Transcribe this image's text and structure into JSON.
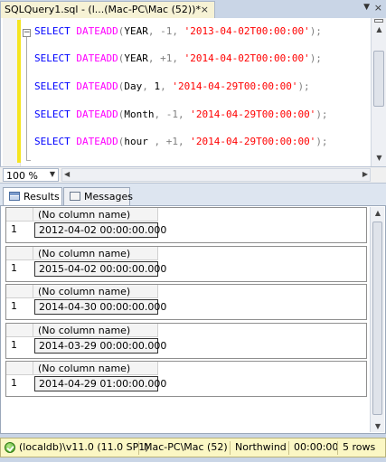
{
  "document_tab": {
    "title": "SQLQuery1.sql - (l...(Mac-PC\\Mac (52))*",
    "close_glyph": "×"
  },
  "editor": {
    "lines": [
      {
        "kw": "SELECT",
        "fn": "DATEADD",
        "open": "(",
        "part": "YEAR",
        "sep1": ", ",
        "num": "-1",
        "sep2": ", ",
        "str": "'2013-04-02T00:00:00'",
        "close": ");"
      },
      {
        "kw": "SELECT",
        "fn": "DATEADD",
        "open": "(",
        "part": "YEAR",
        "sep1": ", ",
        "num": "+1",
        "sep2": ", ",
        "str": "'2014-04-02T00:00:00'",
        "close": ");"
      },
      {
        "kw": "SELECT",
        "fn": "DATEADD",
        "open": "(",
        "part": "Day",
        "sep1": ", ",
        "num": "1",
        "sep2": ", ",
        "str": "'2014-04-29T00:00:00'",
        "close": ");"
      },
      {
        "kw": "SELECT",
        "fn": "DATEADD",
        "open": "(",
        "part": "Month",
        "sep1": ", ",
        "num": "-1",
        "sep2": ", ",
        "str": "'2014-04-29T00:00:00'",
        "close": ");"
      },
      {
        "kw": "SELECT",
        "fn": "DATEADD",
        "open": "(",
        "part": "hour ",
        "sep1": ", ",
        "num": "+1",
        "sep2": ", ",
        "str": "'2014-04-29T00:00:00'",
        "close": ");"
      }
    ],
    "collapse_glyph": "−"
  },
  "zoom": {
    "value": "100 %"
  },
  "result_tabs": {
    "results": "Results",
    "messages": "Messages"
  },
  "result_sets": [
    {
      "column": "(No column name)",
      "row": "1",
      "value": "2012-04-02 00:00:00.000"
    },
    {
      "column": "(No column name)",
      "row": "1",
      "value": "2015-04-02 00:00:00.000"
    },
    {
      "column": "(No column name)",
      "row": "1",
      "value": "2014-04-30 00:00:00.000"
    },
    {
      "column": "(No column name)",
      "row": "1",
      "value": "2014-03-29 00:00:00.000"
    },
    {
      "column": "(No column name)",
      "row": "1",
      "value": "2014-04-29 01:00:00.000"
    }
  ],
  "status": {
    "server": "(localdb)\\v11.0 (11.0 SP1)",
    "user": "Mac-PC\\Mac (52)",
    "database": "Northwind",
    "elapsed": "00:00:00",
    "rows": "5 rows"
  },
  "colors": {
    "keyword": "#0000ff",
    "function": "#ff00ff",
    "string": "#ff0000",
    "status_bg": "#fbf7c4",
    "tab_bg": "#f6f2d5"
  }
}
